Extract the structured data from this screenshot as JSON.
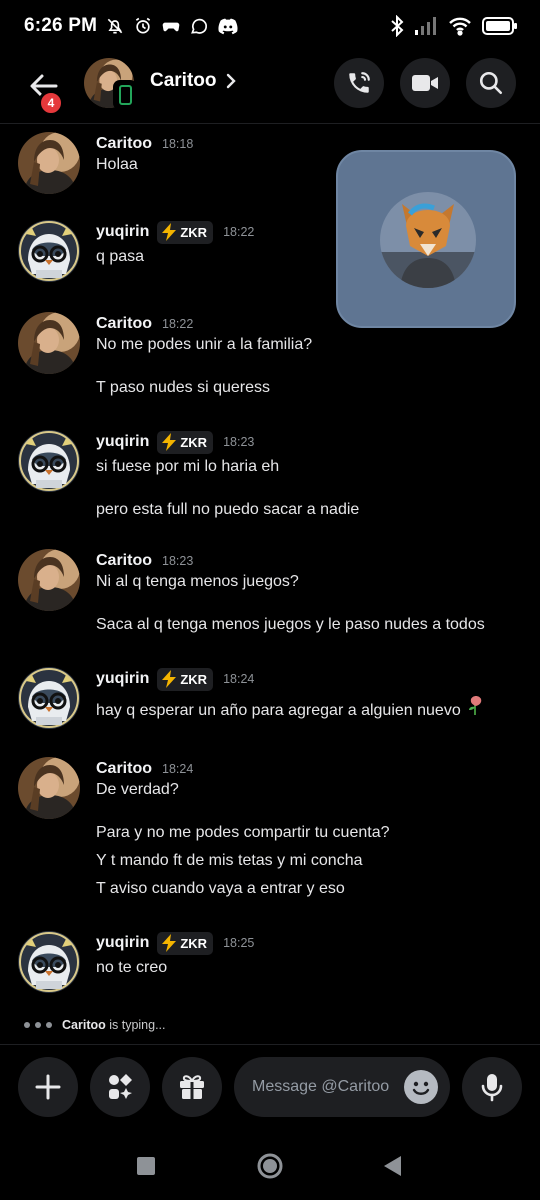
{
  "status_bar": {
    "time": "6:26 PM",
    "left_icons": [
      "bell-off-icon",
      "alarm-icon",
      "game-controller-icon",
      "whatsapp-icon",
      "discord-icon"
    ],
    "right_icons": [
      "bluetooth-icon",
      "signal-icon",
      "wifi-icon",
      "battery-icon"
    ]
  },
  "header": {
    "back_badge": "4",
    "contact_name": "Caritoo",
    "actions": [
      "voice-call-icon",
      "video-call-icon",
      "search-icon"
    ]
  },
  "messages": [
    {
      "author": "Caritoo",
      "time": "18:18",
      "tag": "",
      "lines": [
        "Holaa"
      ]
    },
    {
      "author": "yuqirin",
      "time": "18:22",
      "tag": "ZKR",
      "lines": [
        "q pasa"
      ]
    },
    {
      "author": "Caritoo",
      "time": "18:22",
      "tag": "",
      "lines": [
        "No me podes unir a la familia?",
        "T paso nudes si queress"
      ]
    },
    {
      "author": "yuqirin",
      "time": "18:23",
      "tag": "ZKR",
      "lines": [
        "si fuese por mi lo haria eh",
        "pero esta full no puedo sacar a nadie"
      ]
    },
    {
      "author": "Caritoo",
      "time": "18:23",
      "tag": "",
      "lines": [
        "Ni al q tenga menos juegos?",
        "Saca al q tenga menos juegos y le paso nudes a todos"
      ]
    },
    {
      "author": "yuqirin",
      "time": "18:24",
      "tag": "ZKR",
      "lines": [
        "hay q esperar un año para agregar a alguien nuevo"
      ]
    },
    {
      "author": "Caritoo",
      "time": "18:24",
      "tag": "",
      "lines": [
        "De verdad?",
        "Para y no me podes compartir tu cuenta?",
        "Y t mando ft de mis tetas y mi concha",
        "T aviso cuando vaya a entrar y eso"
      ]
    },
    {
      "author": "yuqirin",
      "time": "18:25",
      "tag": "ZKR",
      "lines": [
        "no te creo"
      ]
    }
  ],
  "typing": {
    "user": "Caritoo",
    "text": " is typing..."
  },
  "composer": {
    "placeholder": "Message @Caritoo"
  },
  "colors": {
    "background": "#000000",
    "surface": "#1e1f22",
    "online": "#23a55a",
    "badge": "#e5383b",
    "pip": "#5f7592"
  }
}
